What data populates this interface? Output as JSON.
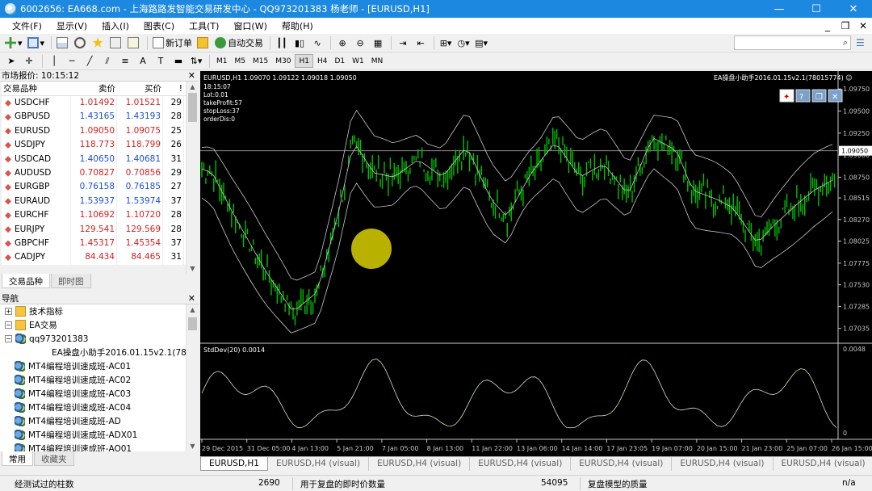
{
  "window": {
    "title": "6002656: EA668.com - 上海路路发智能交易研发中心 - QQ973201383  杨老师 - [EURUSD,H1]",
    "min": "—",
    "max": "☐",
    "close": "✕"
  },
  "menu": [
    "文件(F)",
    "显示(V)",
    "插入(I)",
    "图表(C)",
    "工具(T)",
    "窗口(W)",
    "帮助(H)"
  ],
  "toolbar": {
    "new_order": "新订单",
    "auto_trading": "自动交易"
  },
  "timeframes": [
    "M1",
    "M5",
    "M15",
    "M30",
    "H1",
    "H4",
    "D1",
    "W1",
    "MN"
  ],
  "selected_timeframe": "H1",
  "market_watch": {
    "title": "市场报价: 10:15:12",
    "columns": [
      "交易品种",
      "卖价",
      "买价",
      "!"
    ],
    "rows": [
      {
        "symbol": "USDCHF",
        "bid": "1.01492",
        "ask": "1.01521",
        "spread": "29",
        "dir": "dn"
      },
      {
        "symbol": "GBPUSD",
        "bid": "1.43165",
        "ask": "1.43193",
        "spread": "28",
        "dir": "up"
      },
      {
        "symbol": "EURUSD",
        "bid": "1.09050",
        "ask": "1.09075",
        "spread": "25",
        "dir": "dn"
      },
      {
        "symbol": "USDJPY",
        "bid": "118.773",
        "ask": "118.799",
        "spread": "26",
        "dir": "dn"
      },
      {
        "symbol": "USDCAD",
        "bid": "1.40650",
        "ask": "1.40681",
        "spread": "31",
        "dir": "up"
      },
      {
        "symbol": "AUDUSD",
        "bid": "0.70827",
        "ask": "0.70856",
        "spread": "29",
        "dir": "dn"
      },
      {
        "symbol": "EURGBP",
        "bid": "0.76158",
        "ask": "0.76185",
        "spread": "27",
        "dir": "up"
      },
      {
        "symbol": "EURAUD",
        "bid": "1.53937",
        "ask": "1.53974",
        "spread": "37",
        "dir": "up"
      },
      {
        "symbol": "EURCHF",
        "bid": "1.10692",
        "ask": "1.10720",
        "spread": "28",
        "dir": "dn"
      },
      {
        "symbol": "EURJPY",
        "bid": "129.541",
        "ask": "129.569",
        "spread": "28",
        "dir": "dn"
      },
      {
        "symbol": "GBPCHF",
        "bid": "1.45317",
        "ask": "1.45354",
        "spread": "37",
        "dir": "dn"
      },
      {
        "symbol": "CADJPY",
        "bid": "84.434",
        "ask": "84.465",
        "spread": "31",
        "dir": "dn"
      }
    ],
    "tabs": [
      "交易品种",
      "即时图"
    ]
  },
  "navigator": {
    "title": "导航",
    "items": [
      {
        "label": "技术指标",
        "level": 0,
        "toggle": "+",
        "icon": "folder"
      },
      {
        "label": "EA交易",
        "level": 0,
        "toggle": "−",
        "icon": "folder"
      },
      {
        "label": "qq973201383",
        "level": 1,
        "toggle": "−",
        "icon": "ea"
      },
      {
        "label": "EA操盘小助手2016.01.15v2.1(780",
        "level": 2,
        "toggle": "",
        "icon": "ea"
      },
      {
        "label": "MT4编程培训速成班-AC01",
        "level": 1,
        "toggle": "",
        "icon": "ea"
      },
      {
        "label": "MT4编程培训速成班-AC02",
        "level": 1,
        "toggle": "",
        "icon": "ea"
      },
      {
        "label": "MT4编程培训速成班-AC03",
        "level": 1,
        "toggle": "",
        "icon": "ea"
      },
      {
        "label": "MT4编程培训速成班-AC04",
        "level": 1,
        "toggle": "",
        "icon": "ea"
      },
      {
        "label": "MT4编程培训速成班-AD",
        "level": 1,
        "toggle": "",
        "icon": "ea"
      },
      {
        "label": "MT4编程培训速成班-ADX01",
        "level": 1,
        "toggle": "",
        "icon": "ea"
      },
      {
        "label": "MT4编程培训速成班-AO01",
        "level": 1,
        "toggle": "",
        "icon": "ea"
      }
    ],
    "tabs": [
      "常用",
      "收藏夹"
    ]
  },
  "chart": {
    "header": "EURUSD,H1  1.09070 1.09122 1.09018 1.09050",
    "info_lines": [
      "18:15:07",
      "Lot:0.01",
      "takeProfit:57",
      "stopLoss:37",
      "orderDis:0"
    ],
    "ea_label": "EA操盘小助手2016.01.15v2.1(78015774) ☺",
    "price_axis": [
      "1.09750",
      "1.09500",
      "1.09250",
      "1.09000",
      "1.08750",
      "1.08515",
      "1.08270",
      "1.08025",
      "1.07775",
      "1.07530",
      "1.07285",
      "1.07035"
    ],
    "price_min": 1.0695,
    "price_max": 1.0988,
    "current_price": "1.09050",
    "current_value": 1.0905,
    "indicator_label": "StdDev(20) 0.0014",
    "indicator_axis_top": "0.0048",
    "indicator_axis_bottom": "0",
    "time_axis": [
      "29 Dec 2015",
      "31 Dec 05:00",
      "4 Jan 13:00",
      "5 Jan 21:00",
      "7 Jan 05:00",
      "8 Jan 13:00",
      "11 Jan 22:00",
      "13 Jan 06:00",
      "14 Jan 14:00",
      "17 Jan 23:05",
      "19 Jan 07:00",
      "20 Jan 15:00",
      "21 Jan 23:00",
      "25 Jan 07:00",
      "26 Jan 15:00"
    ],
    "colors": {
      "bg": "#000000",
      "candle": "#00c000",
      "band": "#c8c8c8",
      "indicator": "#c8e6c8"
    },
    "tabs": [
      "EURUSD,H1",
      "EURUSD,H4 (visual)",
      "EURUSD,H4 (visual)",
      "EURUSD,H4 (visual)",
      "EURUSD,H4 (visual)",
      "EURUSD,H4 (visual)",
      "EURUSD,H4 (visual)",
      "EUR"
    ]
  },
  "status": {
    "bars_label": "经测试过的柱数",
    "bars": "2690",
    "ticks_label": "用于复盘的即时价数量",
    "ticks": "54095",
    "quality_label": "复盘模型的质量",
    "quality": "n/a"
  }
}
